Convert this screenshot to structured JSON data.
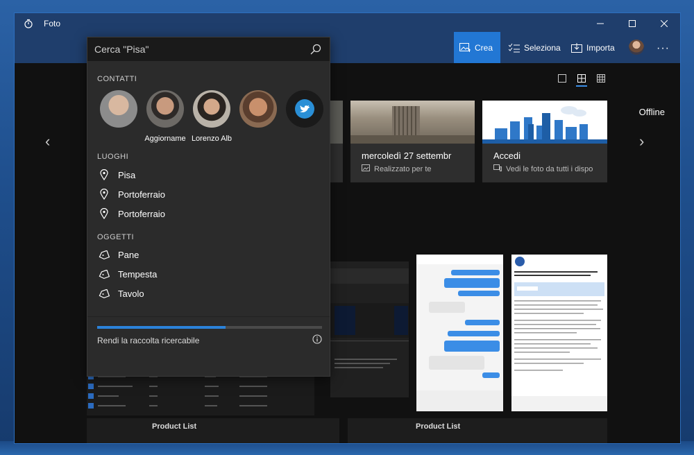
{
  "window": {
    "title": "Foto"
  },
  "toolbar": {
    "crea_label": "Crea",
    "seleziona_label": "Seleziona",
    "importa_label": "Importa"
  },
  "status": {
    "offline": "Offline"
  },
  "cards": [
    {
      "title": "mercoledì 27 settembr",
      "subtitle": "Realizzato per te"
    },
    {
      "title": "Accedi",
      "subtitle": "Vedi le foto da tutti i dispo"
    }
  ],
  "search": {
    "placeholder": "Cerca \"Pisa\"",
    "sections": {
      "contatti": "CONTATTI",
      "luoghi": "LUOGHI",
      "oggetti": "OGGETTI"
    },
    "contacts": [
      {
        "name": ""
      },
      {
        "name": "Aggiorname"
      },
      {
        "name": "Lorenzo Alb"
      },
      {
        "name": ""
      },
      {
        "name": ""
      }
    ],
    "places": [
      "Pisa",
      "Portoferraio",
      "Portoferraio"
    ],
    "objects": [
      "Pane",
      "Tempesta",
      "Tavolo"
    ],
    "index_label": "Rendi la raccolta ricercabile",
    "progress": 0.57
  },
  "strips": {
    "left_title": "Product List",
    "right_title": "Product List"
  },
  "colors": {
    "accent": "#2277d4",
    "titlebar": "#1f3e6c",
    "panel": "#2b2b2b"
  }
}
